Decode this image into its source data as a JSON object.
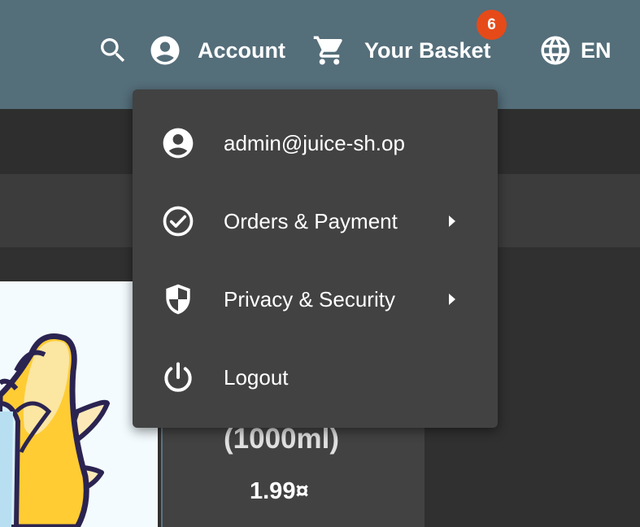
{
  "toolbar": {
    "account_label": "Account",
    "basket_label": "Your Basket",
    "basket_count": "6",
    "language_label": "EN"
  },
  "product": {
    "name_fragment": "(1000ml)",
    "price": "1.99¤"
  },
  "account_menu": {
    "items": [
      {
        "label": "admin@juice-sh.op",
        "icon": "account-circle-icon"
      },
      {
        "label": "Orders & Payment",
        "icon": "check-circle-icon",
        "has_submenu": true
      },
      {
        "label": "Privacy & Security",
        "icon": "shield-icon",
        "has_submenu": true
      },
      {
        "label": "Logout",
        "icon": "power-icon"
      }
    ]
  },
  "colors": {
    "toolbar": "#546e7a",
    "menu_background": "#424242",
    "badge": "#e64a19",
    "page_background": "#303030"
  }
}
